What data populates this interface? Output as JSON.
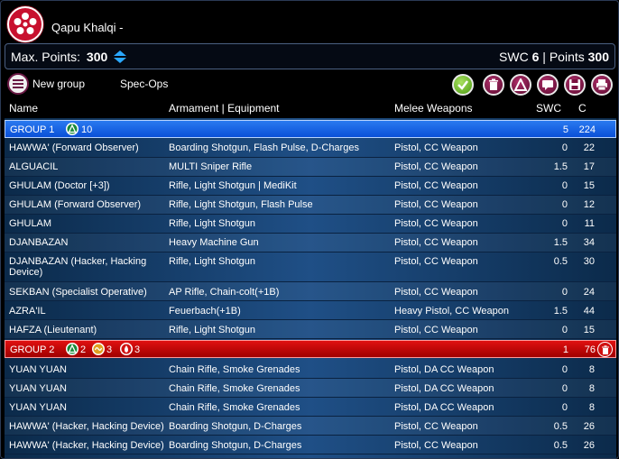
{
  "title": "Qapu Khalqi -",
  "points_bar": {
    "max_points_label": "Max. Points:",
    "max_points_value": "300",
    "swc_label": "SWC",
    "swc_value": "6",
    "separator": "|",
    "points_label": "Points",
    "points_value": "300"
  },
  "toolbar": {
    "new_group_label": "New group",
    "spec_ops_label": "Spec-Ops",
    "buttons": [
      "validate-icon",
      "trash-icon",
      "faction-icon",
      "chat-icon",
      "save-icon",
      "print-icon"
    ]
  },
  "columns": {
    "name": "Name",
    "armament": "Armament | Equipment",
    "melee": "Melee Weapons",
    "swc": "SWC",
    "cost": "C"
  },
  "groups": [
    {
      "label": "GROUP 1",
      "orders": [
        {
          "icon": "regular-order-icon",
          "count": "10"
        }
      ],
      "swc": "5",
      "cost": "224",
      "color": "#1a66e8",
      "units": [
        {
          "name": "HAWWA' (Forward Observer)",
          "armament": "Boarding Shotgun, Flash Pulse, D-Charges",
          "melee": "Pistol, CC Weapon",
          "swc": "0",
          "cost": "22"
        },
        {
          "name": "ALGUACIL",
          "armament": "MULTI Sniper Rifle",
          "melee": "Pistol, CC Weapon",
          "swc": "1.5",
          "cost": "17"
        },
        {
          "name": "GHULAM (Doctor [+3])",
          "armament": "Rifle, Light Shotgun | MediKit",
          "melee": "Pistol, CC Weapon",
          "swc": "0",
          "cost": "15"
        },
        {
          "name": "GHULAM (Forward Observer)",
          "armament": "Rifle, Light Shotgun, Flash Pulse",
          "melee": "Pistol, CC Weapon",
          "swc": "0",
          "cost": "12"
        },
        {
          "name": "GHULAM",
          "armament": "Rifle, Light Shotgun",
          "melee": "Pistol, CC Weapon",
          "swc": "0",
          "cost": "11"
        },
        {
          "name": "DJANBAZAN",
          "armament": "Heavy Machine Gun",
          "melee": "Pistol, CC Weapon",
          "swc": "1.5",
          "cost": "34"
        },
        {
          "name": "DJANBAZAN (Hacker, Hacking Device)",
          "armament": "Rifle, Light Shotgun",
          "melee": "Pistol, CC Weapon",
          "swc": "0.5",
          "cost": "30"
        },
        {
          "name": "SEKBAN (Specialist Operative)",
          "armament": "AP Rifle, Chain-colt(+1B)",
          "melee": "Pistol, CC Weapon",
          "swc": "0",
          "cost": "24"
        },
        {
          "name": "AZRA'IL",
          "armament": "Feuerbach(+1B)",
          "melee": "Heavy Pistol, CC Weapon",
          "swc": "1.5",
          "cost": "44"
        },
        {
          "name": "HAFZA (Lieutenant)",
          "armament": "Rifle, Light Shotgun",
          "melee": "Pistol, CC Weapon",
          "swc": "0",
          "cost": "15"
        }
      ]
    },
    {
      "label": "GROUP 2",
      "orders": [
        {
          "icon": "regular-order-icon",
          "count": "2"
        },
        {
          "icon": "irregular-order-icon",
          "count": "3"
        },
        {
          "icon": "impetuous-order-icon",
          "count": "3"
        }
      ],
      "swc": "1",
      "cost": "76",
      "color": "#d00000",
      "units": [
        {
          "name": "YUAN YUAN",
          "armament": "Chain Rifle, Smoke Grenades",
          "melee": "Pistol, DA CC Weapon",
          "swc": "0",
          "cost": "8"
        },
        {
          "name": "YUAN YUAN",
          "armament": "Chain Rifle, Smoke Grenades",
          "melee": "Pistol, DA CC Weapon",
          "swc": "0",
          "cost": "8"
        },
        {
          "name": "YUAN YUAN",
          "armament": "Chain Rifle, Smoke Grenades",
          "melee": "Pistol, DA CC Weapon",
          "swc": "0",
          "cost": "8"
        },
        {
          "name": "HAWWA' (Hacker, Hacking Device)",
          "armament": "Boarding Shotgun, D-Charges",
          "melee": "Pistol, CC Weapon",
          "swc": "0.5",
          "cost": "26"
        },
        {
          "name": "HAWWA' (Hacker, Hacking Device)",
          "armament": "Boarding Shotgun, D-Charges",
          "melee": "Pistol, CC Weapon",
          "swc": "0.5",
          "cost": "26"
        }
      ]
    }
  ]
}
